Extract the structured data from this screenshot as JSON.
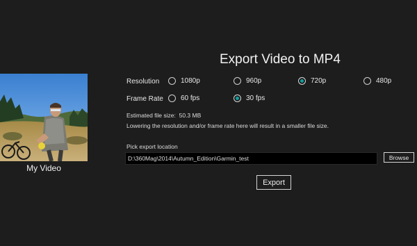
{
  "video": {
    "name": "My Video"
  },
  "dialog": {
    "title": "Export Video to MP4",
    "resolution": {
      "label": "Resolution",
      "options": [
        "1080p",
        "960p",
        "720p",
        "480p"
      ],
      "selected": "720p"
    },
    "frame_rate": {
      "label": "Frame Rate",
      "options": [
        "60 fps",
        "30 fps"
      ],
      "selected": "30 fps"
    },
    "estimated_size_label": "Estimated file size:",
    "estimated_size_value": "50.3 MB",
    "hint": "Lowering the resolution and/or frame rate here will result in a smaller file size.",
    "location_label": "Pick export location",
    "location_value": "D:\\360Mag\\2014\\Autumn_Edition\\Garmin_test",
    "browse_label": "Browse",
    "export_label": "Export"
  },
  "colors": {
    "background": "#1d1d1d",
    "accent": "#11a0a0",
    "path_background": "#000000"
  }
}
